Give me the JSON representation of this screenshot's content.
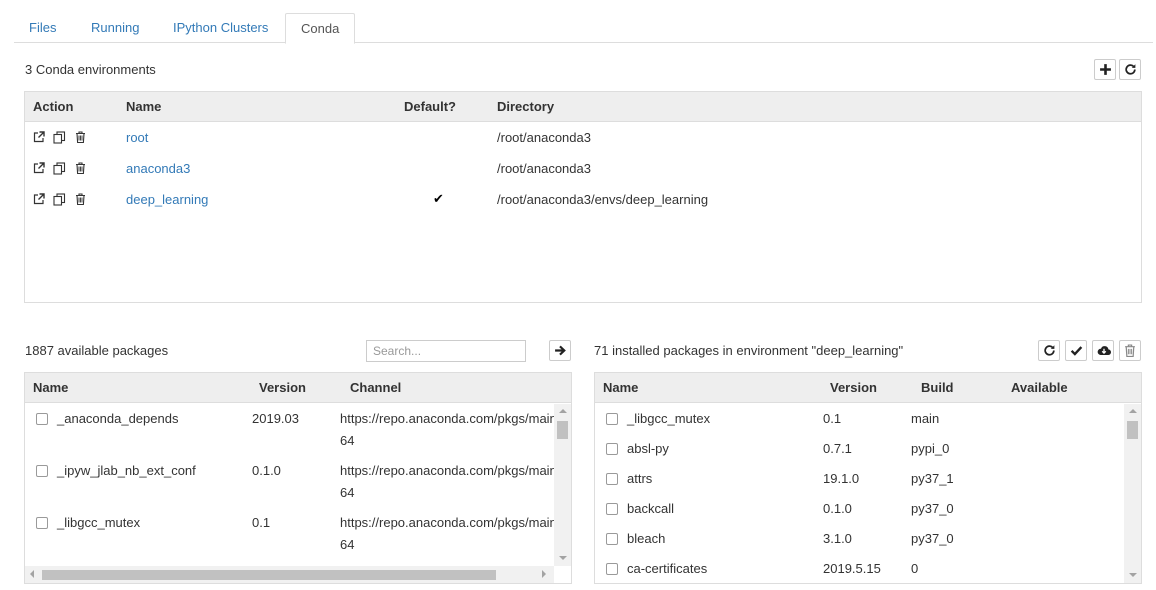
{
  "tabs": [
    {
      "label": "Files"
    },
    {
      "label": "Running"
    },
    {
      "label": "IPython Clusters"
    },
    {
      "label": "Conda"
    }
  ],
  "environments": {
    "count_label": "3 Conda environments",
    "headers": {
      "action": "Action",
      "name": "Name",
      "default": "Default?",
      "directory": "Directory"
    },
    "rows": [
      {
        "name": "root",
        "is_default": false,
        "directory": "/root/anaconda3"
      },
      {
        "name": "anaconda3",
        "is_default": false,
        "directory": "/root/anaconda3"
      },
      {
        "name": "deep_learning",
        "is_default": true,
        "default_mark": "✔",
        "directory": "/root/anaconda3/envs/deep_learning"
      }
    ],
    "action_icons": [
      "external-link-icon",
      "copy-icon",
      "trash-icon"
    ],
    "toolbar_icons": [
      "plus-icon",
      "refresh-icon"
    ]
  },
  "available": {
    "count_label": "1887 available packages",
    "search_placeholder": "Search...",
    "headers": {
      "name": "Name",
      "version": "Version",
      "channel": "Channel"
    },
    "rows": [
      {
        "name": "_anaconda_depends",
        "version": "2019.03",
        "channel": "https://repo.anaconda.com/pkgs/main",
        "channel_wrap": "64"
      },
      {
        "name": "_ipyw_jlab_nb_ext_conf",
        "version": "0.1.0",
        "channel": "https://repo.anaconda.com/pkgs/main",
        "channel_wrap": "64"
      },
      {
        "name": "_libgcc_mutex",
        "version": "0.1",
        "channel": "https://repo.anaconda.com/pkgs/main",
        "channel_wrap": "64"
      }
    ],
    "install_icon": "arrow-right-icon"
  },
  "installed": {
    "count_label": "71 installed packages in environment \"deep_learning\"",
    "headers": {
      "name": "Name",
      "version": "Version",
      "build": "Build",
      "available": "Available"
    },
    "rows": [
      {
        "name": "_libgcc_mutex",
        "version": "0.1",
        "build": "main",
        "available": ""
      },
      {
        "name": "absl-py",
        "version": "0.7.1",
        "build": "pypi_0",
        "available": ""
      },
      {
        "name": "attrs",
        "version": "19.1.0",
        "build": "py37_1",
        "available": ""
      },
      {
        "name": "backcall",
        "version": "0.1.0",
        "build": "py37_0",
        "available": ""
      },
      {
        "name": "bleach",
        "version": "3.1.0",
        "build": "py37_0",
        "available": ""
      },
      {
        "name": "ca-certificates",
        "version": "2019.5.15",
        "build": "0",
        "available": ""
      }
    ],
    "toolbar_icons": [
      "refresh-icon",
      "check-icon",
      "cloud-download-icon",
      "trash-icon"
    ]
  },
  "colors": {
    "link": "#337ab7",
    "header_bg": "#eeeeee",
    "border": "#dddddd"
  }
}
